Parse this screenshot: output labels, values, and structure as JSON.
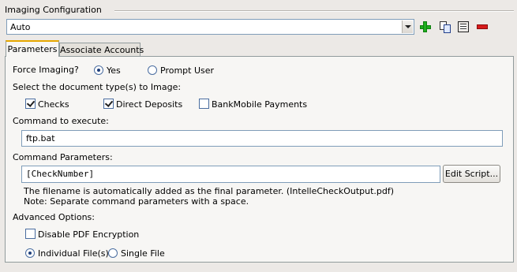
{
  "imaging_configuration": {
    "title": "Imaging Configuration",
    "selected_profile": "Auto"
  },
  "toolbar": {
    "icons": [
      "add-icon",
      "copy-icon",
      "list-icon",
      "remove-icon"
    ]
  },
  "tabs": [
    {
      "label": "Parameters",
      "active": true
    },
    {
      "label": "Associate Accounts",
      "active": false
    }
  ],
  "parameters": {
    "force_imaging_label": "Force Imaging?",
    "force_imaging_options": [
      {
        "label": "Yes",
        "selected": true
      },
      {
        "label": "Prompt User",
        "selected": false
      }
    ],
    "doc_types_label": "Select the document type(s) to Image:",
    "doc_types": [
      {
        "label": "Checks",
        "checked": true
      },
      {
        "label": "Direct Deposits",
        "checked": true
      },
      {
        "label": "BankMobile Payments",
        "checked": false
      }
    ],
    "command_label": "Command to execute:",
    "command_value": "ftp.bat",
    "command_params_label": "Command Parameters:",
    "command_params_value": "[CheckNumber]",
    "edit_script_button": "Edit Script...",
    "note_line1": "The filename is automatically added as the final parameter.  (IntelleCheckOutput.pdf)",
    "note_line2": "Note: Separate command parameters with a space.",
    "advanced_label": "Advanced Options:",
    "disable_pdf_label": "Disable PDF Encryption",
    "disable_pdf_checked": false,
    "output_options": [
      {
        "label": "Individual File(s)",
        "selected": true
      },
      {
        "label": "Single File",
        "selected": false
      }
    ]
  }
}
